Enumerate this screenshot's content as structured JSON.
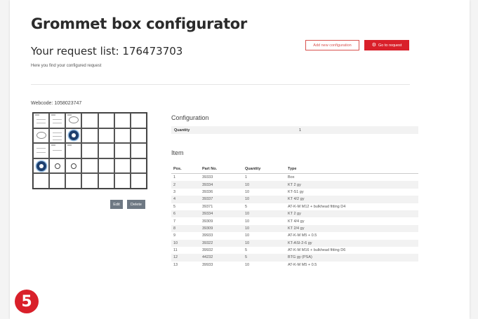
{
  "header": {
    "title": "Grommet box configurator",
    "request_label": "Your request list: 176473703",
    "hint": "Here you find your configured request"
  },
  "actions": {
    "add_config": "Add new configuration",
    "go_to_request": "Go to request"
  },
  "webcode": "Webcode: 1058023747",
  "preview_buttons": {
    "edit": "Edit",
    "delete": "Delete"
  },
  "configuration": {
    "title": "Configuration",
    "quantity_label": "Quantity",
    "quantity_value": "1"
  },
  "items": {
    "title": "Item",
    "columns": [
      "Pos.",
      "Part No.",
      "Quantity",
      "Type"
    ],
    "rows": [
      [
        "1",
        "39333",
        "1",
        "Box"
      ],
      [
        "2",
        "39334",
        "10",
        "KT 2 gy"
      ],
      [
        "3",
        "39336",
        "10",
        "KT-S1 gy"
      ],
      [
        "4",
        "39337",
        "10",
        "KT 4/2 gy"
      ],
      [
        "5",
        "39371",
        "5",
        "AT-K-M M12 + bulkhead fitting D4"
      ],
      [
        "6",
        "39334",
        "10",
        "KT 2 gy"
      ],
      [
        "7",
        "39309",
        "10",
        "KT 4/4 gy"
      ],
      [
        "8",
        "39309",
        "10",
        "KT 2/4 gy"
      ],
      [
        "9",
        "39933",
        "10",
        "AT-K-M M5 + 0.5"
      ],
      [
        "10",
        "39322",
        "10",
        "KT-ASI-2-6 gy"
      ],
      [
        "11",
        "39932",
        "5",
        "AT-K-M M16 + bulkhead fitting D6"
      ],
      [
        "12",
        "44232",
        "5",
        "BTG gy (PSA)"
      ],
      [
        "13",
        "39933",
        "10",
        "AT-K-M M5 + 0.5"
      ]
    ]
  },
  "step_badge": "5"
}
